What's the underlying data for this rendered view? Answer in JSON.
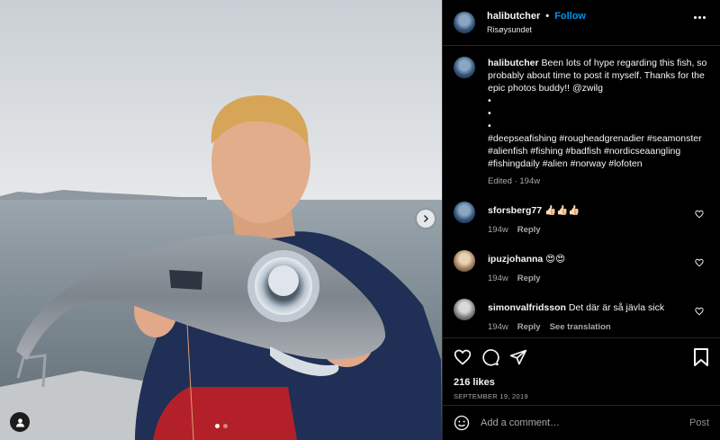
{
  "post": {
    "username": "halibutcher",
    "follow_label": "Follow",
    "location": "Risøysundet",
    "caption": "Been lots of hype regarding this fish, so probably about time to post it myself. Thanks for the epic photos buddy!! @zwilg",
    "caption_bullets": [
      "•",
      "•",
      "•"
    ],
    "hashtags": "#deepseafishing #rougheadgrenadier #seamonster #alienfish #fishing #badfish #nordicseaangling #fishingdaily #alien #norway #lofoten",
    "caption_meta": "Edited · 194w"
  },
  "comments": [
    {
      "username": "sforsberg77",
      "text": "👍🏻👍🏻👍🏻",
      "age": "194w",
      "reply": "Reply",
      "translate": ""
    },
    {
      "username": "ipuzjohanna",
      "text": "😍😍",
      "age": "194w",
      "reply": "Reply",
      "translate": ""
    },
    {
      "username": "simonvalfridsson",
      "text": "Det där är så jävla sick",
      "age": "194w",
      "reply": "Reply",
      "translate": "See translation"
    }
  ],
  "actions": {
    "likes": "216 likes",
    "date": "SEPTEMBER 19, 2019"
  },
  "composer": {
    "placeholder": "Add a comment…",
    "post_label": "Post"
  },
  "colors": {
    "accent": "#0095f6",
    "background": "#000000",
    "muted": "#a8a8a8"
  },
  "icons": [
    "more-options-icon",
    "heart-icon",
    "comment-icon",
    "share-icon",
    "bookmark-icon",
    "emoji-icon",
    "chevron-right-icon",
    "user-tag-icon"
  ],
  "carousel": {
    "count": 2,
    "active": 1
  }
}
